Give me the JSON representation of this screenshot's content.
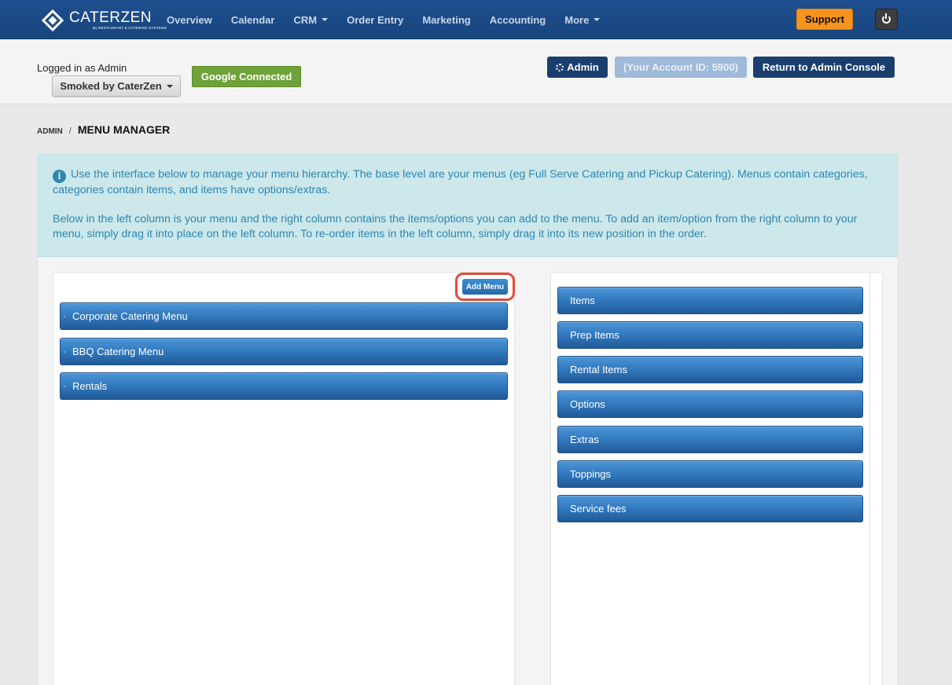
{
  "navbar": {
    "logo": {
      "name": "CATERZEN",
      "tagline": "By RESTAURANT & CATERING SYSTEMS"
    },
    "items": [
      {
        "label": "Overview",
        "dropdown": false
      },
      {
        "label": "Calendar",
        "dropdown": false
      },
      {
        "label": "CRM",
        "dropdown": true
      },
      {
        "label": "Order Entry",
        "dropdown": false
      },
      {
        "label": "Marketing",
        "dropdown": false
      },
      {
        "label": "Accounting",
        "dropdown": false
      },
      {
        "label": "More",
        "dropdown": true
      }
    ],
    "support_label": "Support",
    "power_icon": "power-icon",
    "colors": {
      "navbar": "#1f4f8e",
      "support": "#f7941d"
    }
  },
  "subheader": {
    "logged_in_text": "Logged in as Admin",
    "account_selector": "Smoked by CaterZen",
    "google_label": "Google Connected",
    "admin_label": "Admin",
    "account_id_label": "(Your Account ID: 5900)",
    "return_label": "Return to Admin Console",
    "colors": {
      "google": "#6fa33a",
      "admin": "#1a3f6e"
    }
  },
  "breadcrumb": {
    "parent": "ADMIN",
    "separator": "/",
    "current": "MENU MANAGER"
  },
  "info": {
    "paragraph1": "Use the interface below to manage your menu hierarchy. The base level are your menus (eg Full Serve Catering and Pickup Catering). Menus contain categories, categories contain items, and items have options/extras.",
    "paragraph2": "Below in the left column is your menu and the right column contains the items/options you can add to the menu. To add an item/option from the right column to your menu, simply drag it into place on the left column. To re-order items in the left column, simply drag it into its new position in the order."
  },
  "left_column": {
    "add_menu_label": "Add Menu",
    "menus": [
      "Corporate Catering Menu",
      "BBQ Catering Menu",
      "Rentals"
    ]
  },
  "right_column": {
    "sources": [
      "Items",
      "Prep Items",
      "Rental Items",
      "Options",
      "Extras",
      "Toppings",
      "Service fees"
    ]
  }
}
